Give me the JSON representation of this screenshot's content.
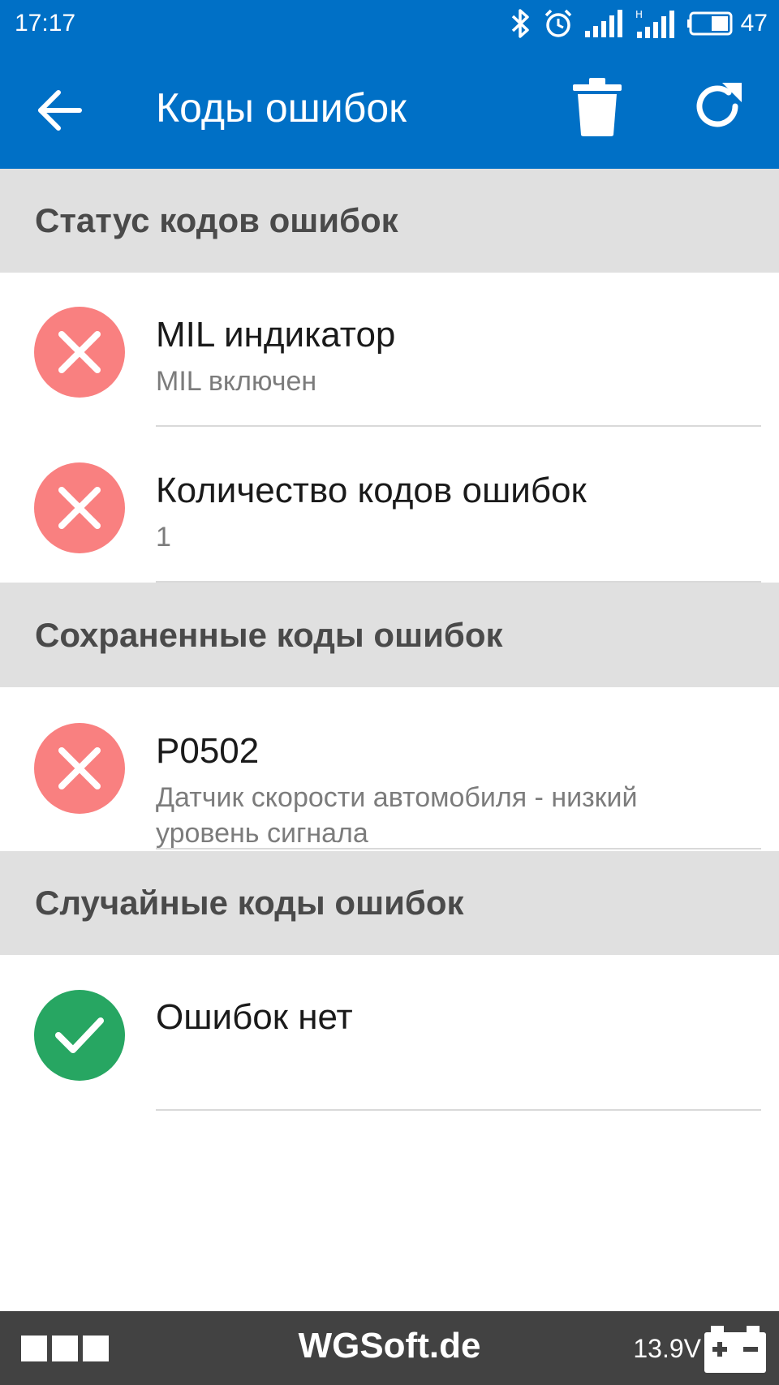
{
  "status_bar": {
    "time": "17:17",
    "battery_level": "47",
    "icons": [
      "bluetooth-icon",
      "alarm-icon",
      "signal-icon",
      "signal-h-icon",
      "battery-icon"
    ]
  },
  "app_bar": {
    "title": "Коды ошибок",
    "icons": [
      "back-arrow-icon",
      "trash-icon",
      "refresh-icon"
    ],
    "color": "#0070c6"
  },
  "sections": {
    "status": {
      "header": "Статус кодов ошибок",
      "items": [
        {
          "title": "MIL индикатор",
          "subtitle": "MIL включен",
          "state": "error"
        },
        {
          "title": "Количество кодов ошибок",
          "subtitle": "1",
          "state": "error"
        }
      ]
    },
    "stored": {
      "header": "Сохраненные коды ошибок",
      "items": [
        {
          "title": "P0502",
          "subtitle": "Датчик скорости автомобиля - низкий уровень сигнала",
          "state": "error"
        }
      ]
    },
    "pending": {
      "header": "Случайные коды ошибок",
      "items": [
        {
          "title": "Ошибок нет",
          "subtitle": "",
          "state": "ok"
        }
      ]
    }
  },
  "bottom_bar": {
    "brand": "WGSoft.de",
    "voltage": "13.9V",
    "icons": [
      "menu-squares-icon",
      "car-battery-icon"
    ]
  },
  "colors": {
    "error_badge": "#f98080",
    "ok_badge": "#27a662",
    "section_bg": "#e0e0e0",
    "bottom_bar": "#424242"
  }
}
